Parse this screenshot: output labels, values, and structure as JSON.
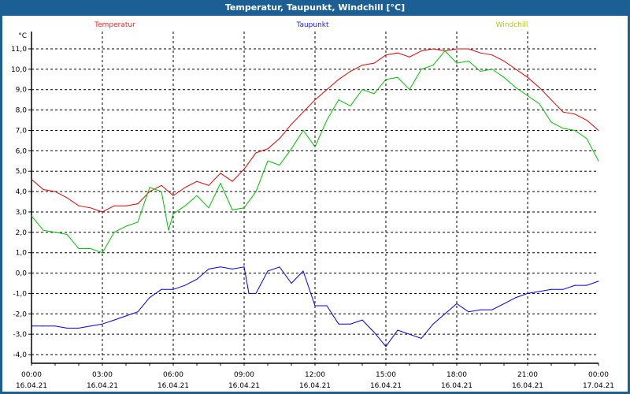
{
  "window": {
    "title": "Temperatur, Taupunkt, Windchill [°C]"
  },
  "chart_data": {
    "type": "line",
    "title": "Temperatur, Taupunkt, Windchill [°C]",
    "ylabel": "°C",
    "ylim": [
      -4.4,
      11.9
    ],
    "xlim": [
      0,
      24
    ],
    "grid": true,
    "legend_placement": "top",
    "yticks": [
      11,
      10,
      9,
      8,
      7,
      6,
      5,
      4,
      3,
      2,
      1,
      0,
      -1,
      -2,
      -3,
      -4
    ],
    "ytick_labels": [
      "11,0",
      "10,0",
      "9,0",
      "8,0",
      "7,0",
      "6,0",
      "5,0",
      "4,0",
      "3,0",
      "2,0",
      "1,0",
      "0,0",
      "-1,0",
      "-2,0",
      "-3,0",
      "-4,0"
    ],
    "xticks": [
      {
        "hour": 0,
        "time": "00:00",
        "date": "16.04.21"
      },
      {
        "hour": 3,
        "time": "03:00",
        "date": "16.04.21"
      },
      {
        "hour": 6,
        "time": "06:00",
        "date": "16.04.21"
      },
      {
        "hour": 9,
        "time": "09:00",
        "date": "16.04.21"
      },
      {
        "hour": 12,
        "time": "12:00",
        "date": "16.04.21"
      },
      {
        "hour": 15,
        "time": "15:00",
        "date": "16.04.21"
      },
      {
        "hour": 18,
        "time": "18:00",
        "date": "16.04.21"
      },
      {
        "hour": 21,
        "time": "21:00",
        "date": "16.04.21"
      },
      {
        "hour": 24,
        "time": "00:00",
        "date": "17.04.21"
      }
    ],
    "series": [
      {
        "name": "Temperatur",
        "color": "#e00000",
        "label_color": "#ff2020",
        "x": [
          0,
          0.5,
          1,
          1.5,
          2,
          2.5,
          3,
          3.5,
          4,
          4.5,
          5,
          5.5,
          6,
          6.5,
          7,
          7.5,
          8,
          8.5,
          9,
          9.5,
          10,
          10.5,
          11,
          11.5,
          12,
          12.5,
          13,
          13.5,
          14,
          14.5,
          15,
          15.5,
          16,
          16.5,
          17,
          17.5,
          18,
          18.5,
          19,
          19.5,
          20,
          20.5,
          21,
          21.5,
          22,
          22.5,
          23,
          23.5,
          24
        ],
        "values": [
          4.6,
          4.1,
          4.0,
          3.7,
          3.3,
          3.2,
          3.0,
          3.3,
          3.3,
          3.4,
          4.0,
          4.3,
          3.8,
          4.2,
          4.5,
          4.3,
          4.9,
          4.5,
          5.1,
          5.9,
          6.1,
          6.6,
          7.3,
          7.9,
          8.5,
          9.0,
          9.5,
          9.9,
          10.2,
          10.3,
          10.7,
          10.8,
          10.6,
          10.9,
          11.0,
          10.9,
          11.0,
          11.0,
          10.8,
          10.7,
          10.4,
          10.0,
          9.6,
          9.1,
          8.5,
          7.9,
          7.8,
          7.5,
          7.0
        ]
      },
      {
        "name": "Taupunkt",
        "color": "#0000e0",
        "label_color": "#2020ff",
        "x": [
          0,
          0.5,
          1,
          1.5,
          2,
          2.5,
          3,
          3.5,
          4,
          4.5,
          5,
          5.5,
          6,
          6.5,
          7,
          7.5,
          8,
          8.5,
          9,
          9.2,
          9.5,
          10,
          10.5,
          11,
          11.5,
          12,
          12.5,
          13,
          13.5,
          14,
          14.5,
          15,
          15.5,
          16,
          16.5,
          17,
          17.5,
          18,
          18.5,
          19,
          19.5,
          20,
          20.5,
          21,
          21.5,
          22,
          22.5,
          23,
          23.5,
          24
        ],
        "values": [
          -2.6,
          -2.6,
          -2.6,
          -2.7,
          -2.7,
          -2.6,
          -2.5,
          -2.3,
          -2.1,
          -1.9,
          -1.2,
          -0.8,
          -0.8,
          -0.6,
          -0.3,
          0.2,
          0.3,
          0.2,
          0.3,
          -1.0,
          -1.0,
          0.1,
          0.3,
          -0.5,
          0.1,
          -1.6,
          -1.6,
          -2.5,
          -2.5,
          -2.3,
          -2.9,
          -3.6,
          -2.8,
          -3.0,
          -3.2,
          -2.5,
          -2.0,
          -1.5,
          -1.9,
          -1.8,
          -1.8,
          -1.5,
          -1.2,
          -1.0,
          -0.9,
          -0.8,
          -0.8,
          -0.6,
          -0.6,
          -0.4
        ]
      },
      {
        "name": "Windchill",
        "color": "#00c000",
        "label_color": "#b8c800",
        "x": [
          0,
          0.5,
          1,
          1.5,
          2,
          2.5,
          3,
          3.5,
          4,
          4.5,
          5,
          5.5,
          5.8,
          6,
          6.5,
          7,
          7.5,
          8,
          8.5,
          9,
          9.5,
          10,
          10.5,
          11,
          11.5,
          12,
          12.5,
          13,
          13.5,
          14,
          14.5,
          15,
          15.5,
          16,
          16.5,
          17,
          17.5,
          18,
          18.5,
          19,
          19.5,
          20,
          20.5,
          21,
          21.5,
          22,
          22.5,
          23,
          23.5,
          24
        ],
        "values": [
          2.8,
          2.1,
          2.0,
          1.9,
          1.2,
          1.2,
          1.0,
          2.0,
          2.3,
          2.5,
          4.2,
          4.0,
          2.1,
          2.9,
          3.3,
          3.8,
          3.2,
          4.4,
          3.1,
          3.2,
          4.0,
          5.5,
          5.3,
          6.1,
          7.0,
          6.2,
          7.5,
          8.5,
          8.2,
          9.0,
          8.8,
          9.5,
          9.6,
          9.0,
          10.0,
          10.2,
          10.9,
          10.3,
          10.4,
          9.9,
          10.0,
          9.6,
          9.1,
          8.7,
          8.3,
          7.4,
          7.1,
          7.0,
          6.6,
          5.5
        ]
      }
    ]
  }
}
